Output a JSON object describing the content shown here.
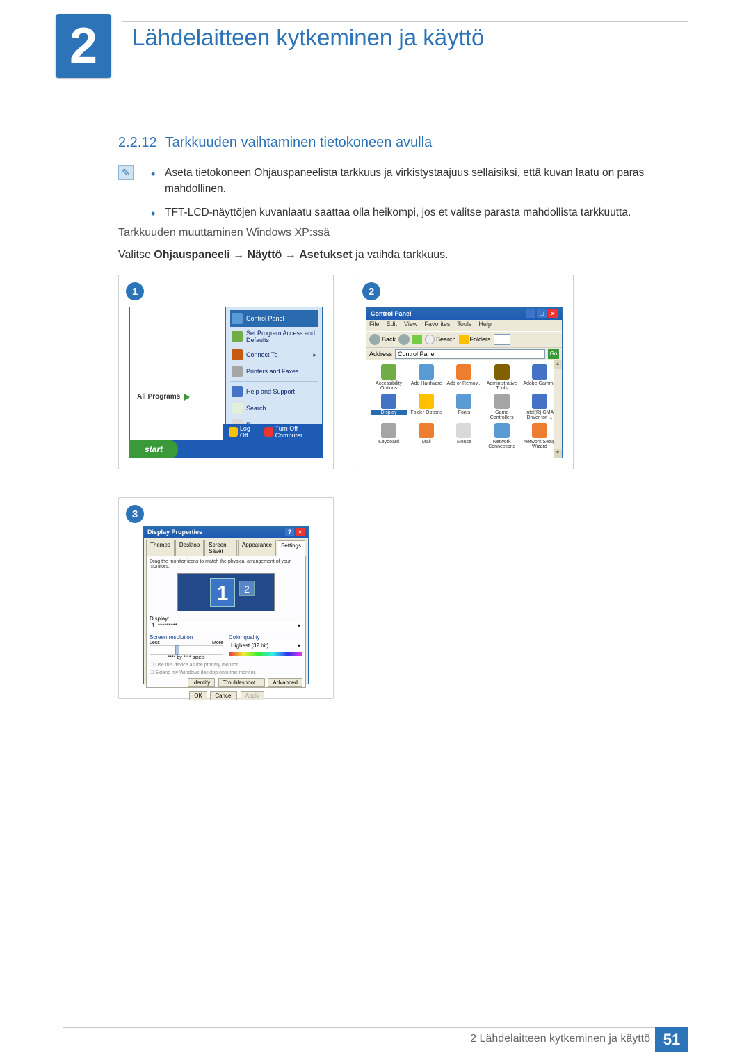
{
  "chapter": {
    "number": "2",
    "title": "Lähdelaitteen kytkeminen ja käyttö"
  },
  "section": {
    "number": "2.2.12",
    "title": "Tarkkuuden vaihtaminen tietokoneen avulla"
  },
  "bullets": [
    "Aseta tietokoneen Ohjauspaneelista tarkkuus ja virkistystaajuus sellaisiksi, että kuvan laatu on paras mahdollinen.",
    "TFT-LCD-näyttöjen kuvanlaatu saattaa olla heikompi, jos et valitse parasta mahdollista tarkkuutta."
  ],
  "body1": "Tarkkuuden muuttaminen Windows XP:ssä",
  "body2": {
    "pre": "Valitse ",
    "b1": "Ohjauspaneeli",
    "arr": " → ",
    "b2": "Näyttö",
    "b3": "Asetukset",
    "post": " ja vaihda tarkkuus."
  },
  "steps": {
    "s1": "1",
    "s2": "2",
    "s3": "3"
  },
  "start_menu": {
    "all_programs": "All Programs",
    "start": "start",
    "logoff": "Log Off",
    "turnoff": "Turn Off Computer",
    "items": [
      {
        "label": "Control Panel",
        "selected": true,
        "color": "#5b9bd5"
      },
      {
        "label": "Set Program Access and Defaults",
        "color": "#70ad47"
      },
      {
        "label": "Connect To",
        "color": "#c55a11",
        "arrow": true
      },
      {
        "label": "Printers and Faxes",
        "color": "#a5a5a5"
      },
      {
        "label": "",
        "hr": true
      },
      {
        "label": "Help and Support",
        "color": "#4472c4"
      },
      {
        "label": "Search",
        "color": "#e2efda"
      },
      {
        "label": "Run...",
        "color": "#d9d9d9"
      }
    ]
  },
  "control_panel": {
    "title": "Control Panel",
    "menus": [
      "File",
      "Edit",
      "View",
      "Favorites",
      "Tools",
      "Help"
    ],
    "toolbar": {
      "back": "Back",
      "search": "Search",
      "folders": "Folders"
    },
    "address_label": "Address",
    "address_value": "Control Panel",
    "go": "Go",
    "items": [
      {
        "label": "Accessibility Options",
        "color": "#70ad47"
      },
      {
        "label": "Add Hardware",
        "color": "#5b9bd5"
      },
      {
        "label": "Add or Remov...",
        "color": "#ed7d31"
      },
      {
        "label": "Administrative Tools",
        "color": "#806000"
      },
      {
        "label": "Adobe Gamma",
        "color": "#4472c4"
      },
      {
        "label": "Display",
        "color": "#4472c4",
        "selected": true
      },
      {
        "label": "Folder Options",
        "color": "#ffc000"
      },
      {
        "label": "Fonts",
        "color": "#5b9bd5"
      },
      {
        "label": "Game Controllers",
        "color": "#a5a5a5"
      },
      {
        "label": "Intel(R) GMA Driver for ...",
        "color": "#4472c4"
      },
      {
        "label": "Keyboard",
        "color": "#a5a5a5"
      },
      {
        "label": "Mail",
        "color": "#ed7d31"
      },
      {
        "label": "Mouse",
        "color": "#d9d9d9"
      },
      {
        "label": "Network Connections",
        "color": "#5b9bd5"
      },
      {
        "label": "Network Setup Wizard",
        "color": "#ed7d31"
      }
    ]
  },
  "display_props": {
    "title": "Display Properties",
    "tabs": [
      "Themes",
      "Desktop",
      "Screen Saver",
      "Appearance",
      "Settings"
    ],
    "active_tab": 4,
    "hint": "Drag the monitor icons to match the physical arrangement of your monitors.",
    "mon1": "1",
    "mon2": "2",
    "display_label": "Display:",
    "display_value": "1. *********",
    "res_header": "Screen resolution",
    "less": "Less",
    "more": "More",
    "res_value": "**** by **** pixels",
    "cq_header": "Color quality",
    "cq_value": "Highest (32 bit)",
    "chk1": "Use this device as the primary monitor.",
    "chk2": "Extend my Windows desktop onto this monitor.",
    "btn_identify": "Identify",
    "btn_trouble": "Troubleshoot...",
    "btn_adv": "Advanced",
    "btn_ok": "OK",
    "btn_cancel": "Cancel",
    "btn_apply": "Apply"
  },
  "footer": {
    "text": "2 Lähdelaitteen kytkeminen ja käyttö",
    "page": "51"
  }
}
